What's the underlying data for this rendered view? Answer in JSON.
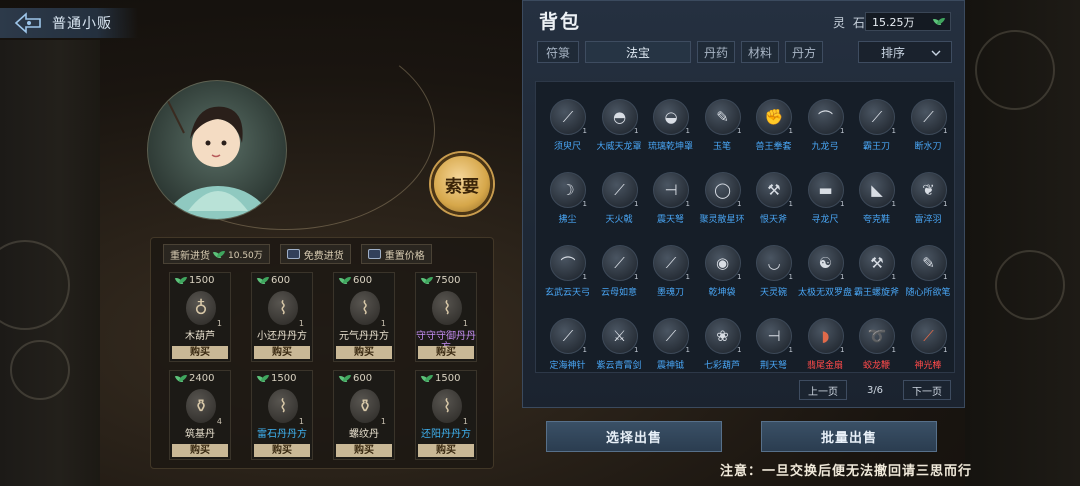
{
  "header": {
    "title": "普通小贩"
  },
  "npc": {
    "request_label": "索要"
  },
  "shop": {
    "restock_label": "重新进货",
    "restock_cost": "10.50万",
    "free_restock_label": "免费进货",
    "reset_price_label": "重置价格",
    "buy_label": "购买",
    "items": [
      {
        "price": "1500",
        "name": "木葫芦",
        "qty": "1",
        "quality": "white",
        "icon": "gourd-icon"
      },
      {
        "price": "600",
        "name": "小还丹丹方",
        "qty": "1",
        "quality": "white",
        "icon": "scroll-icon"
      },
      {
        "price": "600",
        "name": "元气丹丹方",
        "qty": "1",
        "quality": "white",
        "icon": "scroll-icon"
      },
      {
        "price": "7500",
        "name": "守守守御丹丹方",
        "qty": "1",
        "quality": "purple",
        "icon": "scroll-icon"
      },
      {
        "price": "2400",
        "name": "筑基丹",
        "qty": "4",
        "quality": "white",
        "icon": "potion-icon"
      },
      {
        "price": "1500",
        "name": "雷石丹丹方",
        "qty": "1",
        "quality": "blue",
        "icon": "scroll-icon"
      },
      {
        "price": "600",
        "name": "螺纹丹",
        "qty": "1",
        "quality": "white",
        "icon": "potion-icon"
      },
      {
        "price": "1500",
        "name": "还阳丹丹方",
        "qty": "1",
        "quality": "blue",
        "icon": "scroll-icon"
      }
    ]
  },
  "bag": {
    "title": "背包",
    "stone_label": "灵 石",
    "stone_value": "15.25万",
    "tabs": [
      "符箓",
      "法宝",
      "丹药",
      "材料",
      "丹方"
    ],
    "active_tab": "法宝",
    "sort_label": "排序",
    "items": [
      {
        "name": "须臾尺",
        "q": "blue",
        "g": "⟋"
      },
      {
        "name": "大威天龙罩",
        "q": "blue",
        "g": "◓"
      },
      {
        "name": "琉璃乾坤罩",
        "q": "blue",
        "g": "◒"
      },
      {
        "name": "玉笔",
        "q": "blue",
        "g": "✎"
      },
      {
        "name": "兽王拳套",
        "q": "blue",
        "g": "✊"
      },
      {
        "name": "九龙弓",
        "q": "blue",
        "g": "⌒"
      },
      {
        "name": "霸王刀",
        "q": "blue",
        "g": "⟋"
      },
      {
        "name": "断水刀",
        "q": "blue",
        "g": "⟋"
      },
      {
        "name": "拂尘",
        "q": "blue",
        "g": "☽"
      },
      {
        "name": "天火戟",
        "q": "blue",
        "g": "⟋"
      },
      {
        "name": "震天弩",
        "q": "blue",
        "g": "⊣"
      },
      {
        "name": "聚灵散星环",
        "q": "blue",
        "g": "◯"
      },
      {
        "name": "恨天斧",
        "q": "blue",
        "g": "⚒"
      },
      {
        "name": "寻龙尺",
        "q": "blue",
        "g": "▬"
      },
      {
        "name": "夸克鞋",
        "q": "blue",
        "g": "◣"
      },
      {
        "name": "雷淬羽",
        "q": "blue",
        "g": "❦"
      },
      {
        "name": "玄武云天弓",
        "q": "blue",
        "g": "⌒"
      },
      {
        "name": "云母如意",
        "q": "blue",
        "g": "⟋"
      },
      {
        "name": "墨魂刀",
        "q": "blue",
        "g": "⟋"
      },
      {
        "name": "乾坤袋",
        "q": "blue",
        "g": "◉"
      },
      {
        "name": "天灵碗",
        "q": "blue",
        "g": "◡"
      },
      {
        "name": "太极无双罗盘",
        "q": "blue",
        "g": "☯"
      },
      {
        "name": "霸王螺旋斧",
        "q": "blue",
        "g": "⚒"
      },
      {
        "name": "随心所欲笔",
        "q": "blue",
        "g": "✎"
      },
      {
        "name": "定海神针",
        "q": "blue",
        "g": "⟋"
      },
      {
        "name": "紫云青霄剑",
        "q": "blue",
        "g": "⚔"
      },
      {
        "name": "震神钺",
        "q": "blue",
        "g": "⟋"
      },
      {
        "name": "七彩葫芦",
        "q": "blue",
        "g": "❀"
      },
      {
        "name": "荆天弩",
        "q": "blue",
        "g": "⊣"
      },
      {
        "name": "翡尾金扇",
        "q": "red",
        "g": "◗"
      },
      {
        "name": "蛟龙鞭",
        "q": "red",
        "g": "➰"
      },
      {
        "name": "神光棒",
        "q": "red",
        "g": "⟋"
      }
    ],
    "prev_label": "上一页",
    "page_text": "3/6",
    "next_label": "下一页"
  },
  "actions": {
    "select_sell": "选择出售",
    "batch_sell": "批量出售"
  },
  "notice": "注意：一旦交换后便无法撤回请三思而行",
  "colors": {
    "blue": "#49a6f5",
    "purple": "#c079ff",
    "red": "#ff4a4a",
    "gold": "#d6a74a"
  }
}
